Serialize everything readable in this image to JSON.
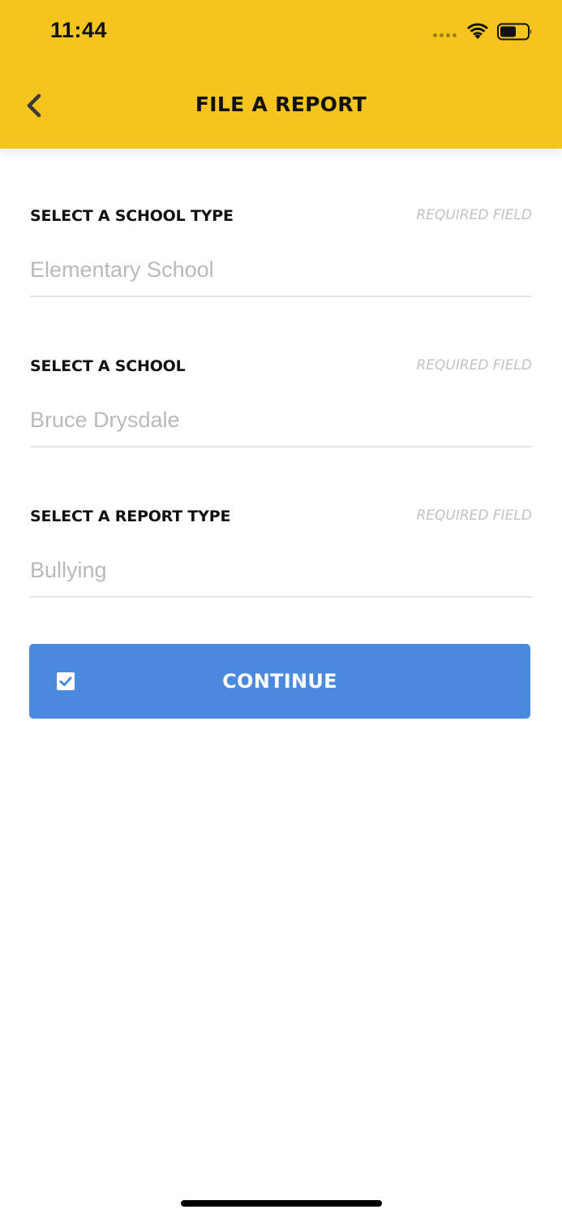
{
  "status_bar": {
    "time": "11:44"
  },
  "nav": {
    "title": "FILE A REPORT",
    "back_icon": "chevron-left-icon"
  },
  "form": {
    "fields": [
      {
        "label": "SELECT A SCHOOL TYPE",
        "required": "REQUIRED FIELD",
        "value": "Elementary School"
      },
      {
        "label": "SELECT A SCHOOL",
        "required": "REQUIRED FIELD",
        "value": "Bruce Drysdale"
      },
      {
        "label": "SELECT A REPORT TYPE",
        "required": "REQUIRED FIELD",
        "value": "Bullying"
      }
    ]
  },
  "continue": {
    "label": "CONTINUE",
    "icon": "checkbox-checked-icon"
  },
  "colors": {
    "header": "#F5C41F",
    "button": "#4A89DC",
    "value_text": "#B9B9B9",
    "required_text": "#C2C2C2"
  }
}
